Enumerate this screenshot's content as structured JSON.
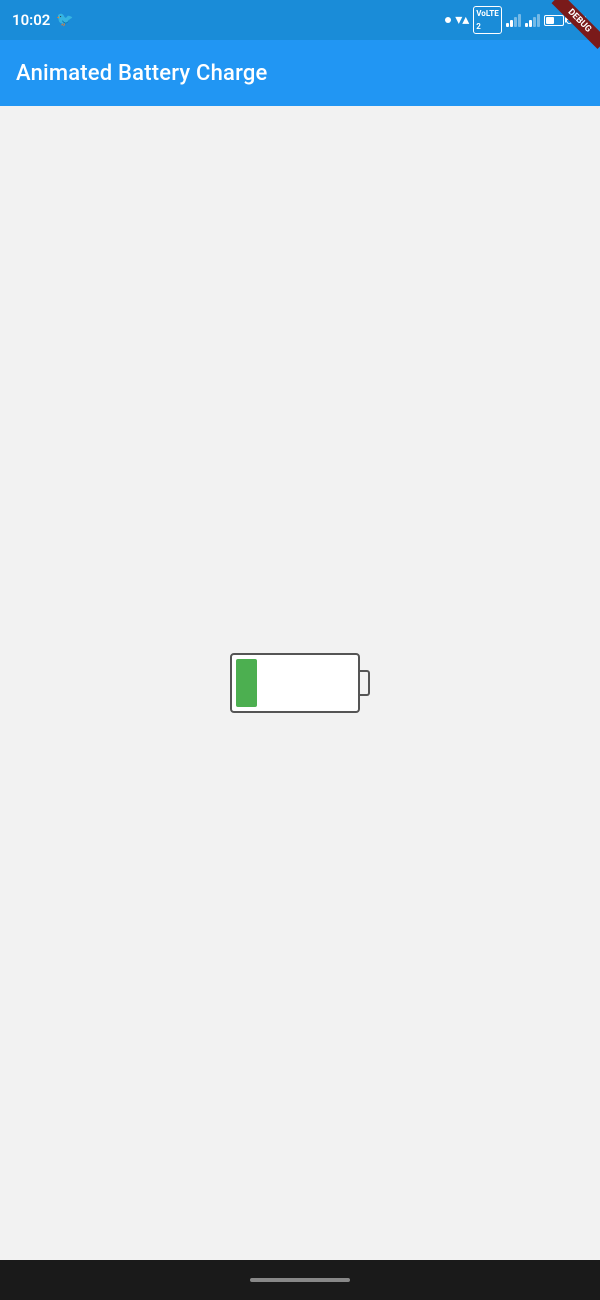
{
  "status_bar": {
    "time": "10:02",
    "battery_percent": "52%"
  },
  "app_bar": {
    "title": "Animated Battery Charge"
  },
  "debug": {
    "label": "DEBUG"
  },
  "battery": {
    "charge_level": 18,
    "color": "#4caf50"
  },
  "bottom": {
    "indicator": ""
  }
}
